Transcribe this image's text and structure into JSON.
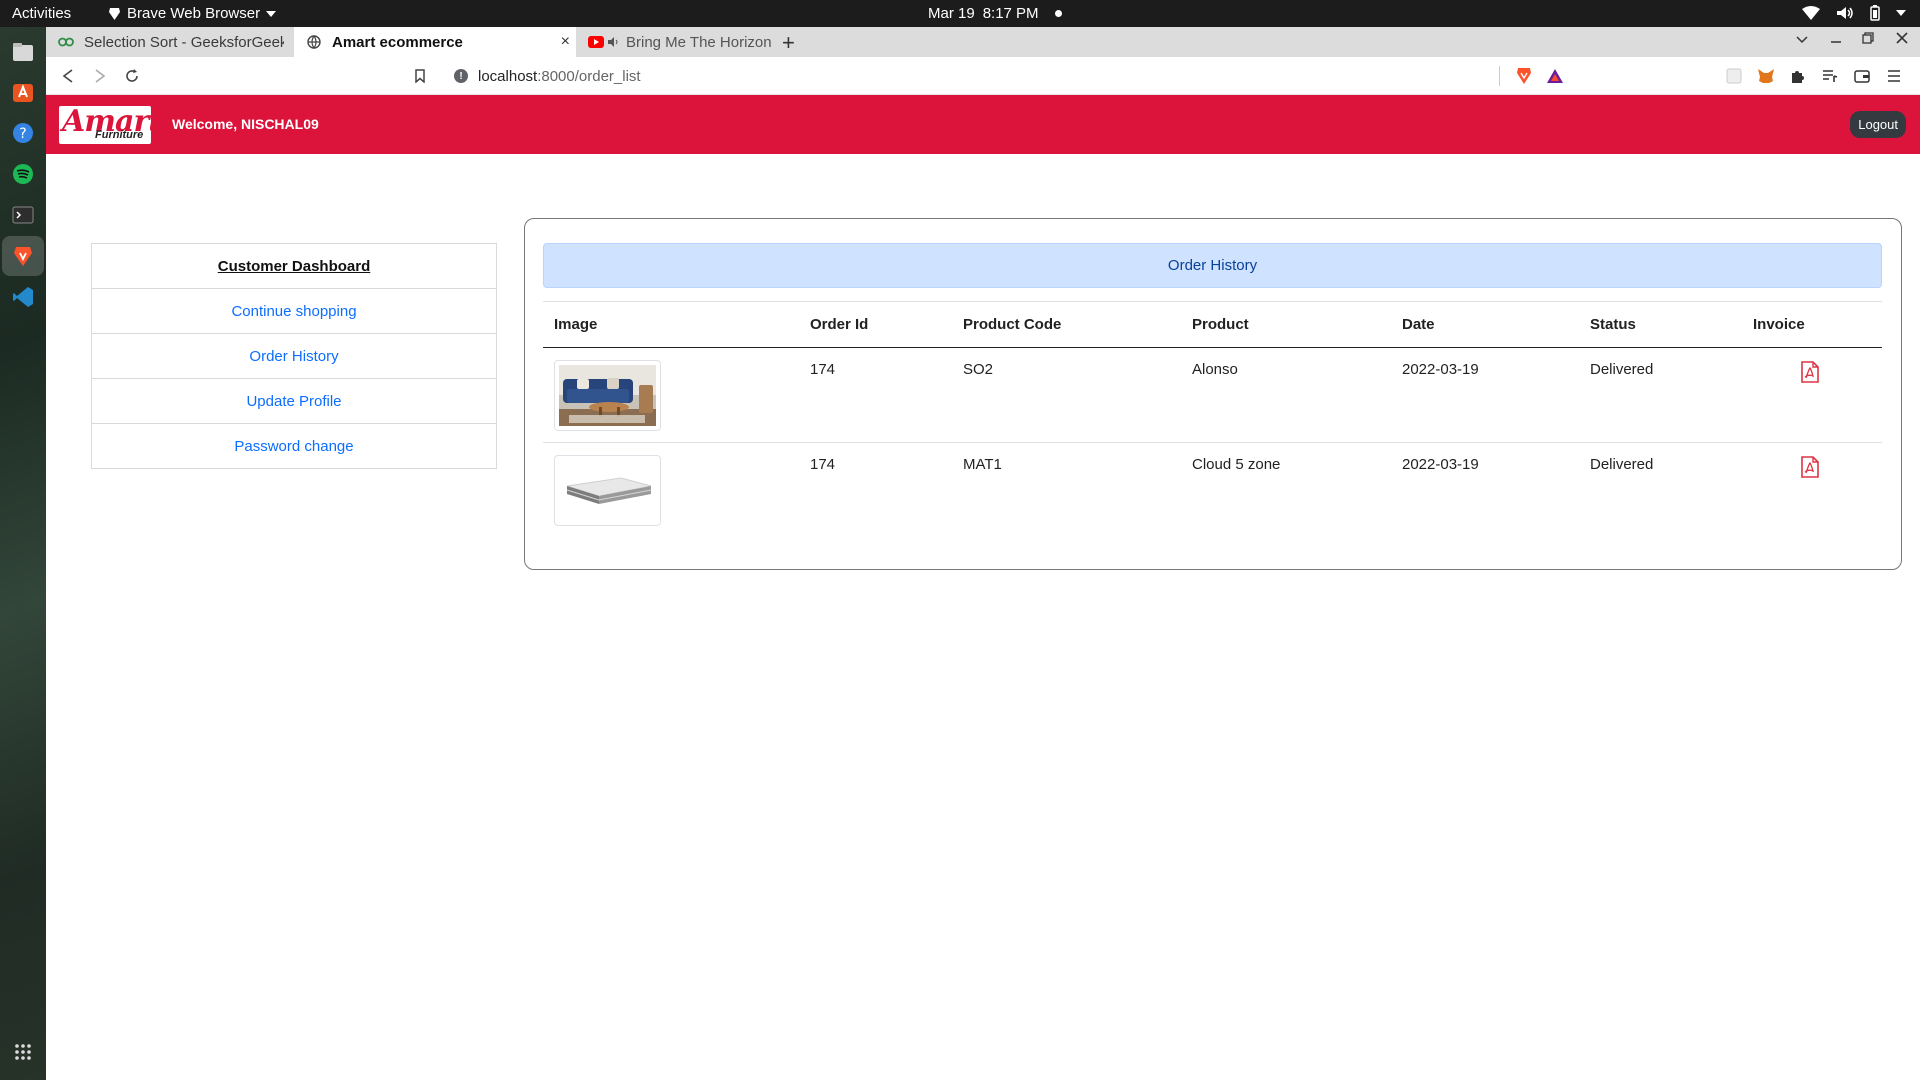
{
  "system": {
    "activities": "Activities",
    "app_name": "Brave Web Browser",
    "date": "Mar 19",
    "time": "8:17 PM"
  },
  "browser": {
    "tabs": [
      {
        "title": "Selection Sort - GeeksforGeek",
        "icon": "geeksforgeeks-icon"
      },
      {
        "title": "Amart ecommerce",
        "icon": "globe-icon"
      },
      {
        "title": "Bring Me The Horizon - MA",
        "icon": "youtube-icon"
      }
    ],
    "url_host": "localhost",
    "url_rest": ":8000/order_list"
  },
  "site": {
    "logo_main": "Amart",
    "logo_sub": "Furniture",
    "welcome": "Welcome, NISCHAL09",
    "logout": "Logout",
    "accent_color": "#dc143c"
  },
  "sidebar": {
    "heading": "Customer Dashboard",
    "items": [
      {
        "label": "Continue shopping"
      },
      {
        "label": "Order History"
      },
      {
        "label": "Update Profile"
      },
      {
        "label": "Password change"
      }
    ]
  },
  "orders": {
    "heading": "Order History",
    "columns": [
      "Image",
      "Order Id",
      "Product Code",
      "Product",
      "Date",
      "Status",
      "Invoice"
    ],
    "rows": [
      {
        "image": "sofa-image",
        "order_id": "174",
        "product_code": "SO2",
        "product": "Alonso",
        "date": "2022-03-19",
        "status": "Delivered",
        "invoice": "pdf-icon"
      },
      {
        "image": "mattress-image",
        "order_id": "174",
        "product_code": "MAT1",
        "product": "Cloud 5 zone",
        "date": "2022-03-19",
        "status": "Delivered",
        "invoice": "pdf-icon"
      }
    ]
  }
}
